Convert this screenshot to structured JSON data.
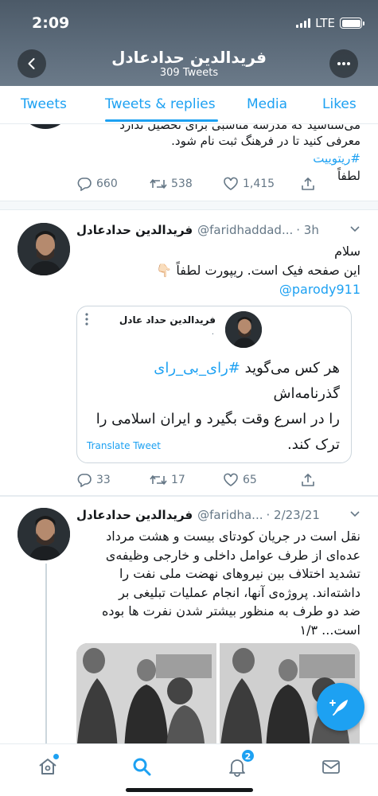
{
  "status_bar": {
    "time": "2:09",
    "network": "LTE"
  },
  "header": {
    "title": "فریدالدین حدادعادل",
    "subtitle": "309 Tweets"
  },
  "tabs": [
    {
      "label": "Tweets",
      "active": false
    },
    {
      "label": "Tweets & replies",
      "active": true
    },
    {
      "label": "Media",
      "active": false
    },
    {
      "label": "Likes",
      "active": false
    }
  ],
  "tweets": [
    {
      "cut_off_text": "می‌شناسید که مدرسه مناسبی برای تحصیل ندارد",
      "body_line2": "معرفی کنید تا در فرهنگ ثبت نام شود.",
      "hashtag": "#ریتوییت",
      "body_line3": "لطفاً",
      "replies": "660",
      "retweets": "538",
      "likes": "1,415"
    },
    {
      "name": "فریدالدین حدادعادل",
      "handle": "@faridhaddad...",
      "time": "· 3h",
      "body_line1": "سلام",
      "body_line2": "این صفحه  فیک است. ریپورت لطفاً 👇🏻",
      "mention": "@parody911",
      "quoted": {
        "name": "فریدالدین حداد عادل",
        "dot": "·",
        "text_line1_pre": "هر کس می‌گوید",
        "text_hashtag": "#رای_بی_رای",
        "text_line1_post": "گذرنامه‌اش",
        "text_line2": "را در اسرع وقت بگیرد و ایران اسلامی را",
        "text_line3": "ترک کند.",
        "translate": "Translate Tweet"
      },
      "replies": "33",
      "retweets": "17",
      "likes": "65"
    },
    {
      "name": "فریدالدین حدادعادل",
      "handle": "@faridha...",
      "time": "· 2/23/21",
      "lines": [
        "نقل است در جریان کودتای بیست و هشت مرداد",
        "عده‌ای از طرف عوامل داخلی و خارجی وظیفه‌ی",
        "تشدید اختلاف بین نیروهای نهضت ملی نفت را",
        "داشته‌اند. پروژه‌ی آنها، انجام عملیات تبلیغی بر",
        "ضد دو طرف به منظور بیشتر شدن نفرت ها بوده",
        "است... ۱/۳"
      ]
    }
  ],
  "bottom_nav": {
    "notifications_badge": "2"
  },
  "colors": {
    "accent": "#1da1f2",
    "text": "#14171a",
    "muted": "#657786",
    "border": "#e6ecf0"
  }
}
